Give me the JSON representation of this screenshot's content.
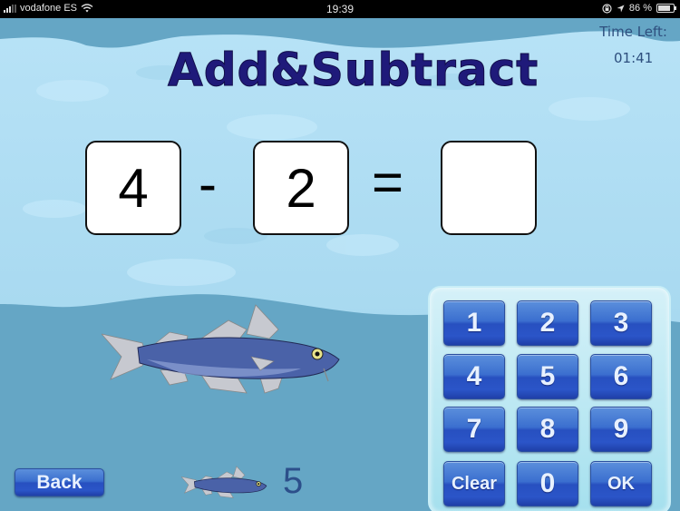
{
  "status_bar": {
    "carrier": "vodafone ES",
    "time": "19:39",
    "battery_percent": "86 %",
    "battery_level": 0.86
  },
  "header": {
    "title": "Add&Subtract",
    "timer_label": "Time Left:",
    "timer_value": "01:41"
  },
  "equation": {
    "operand1": "4",
    "operator": "-",
    "operand2": "2",
    "equals": "=",
    "answer": ""
  },
  "keypad": {
    "keys": [
      "1",
      "2",
      "3",
      "4",
      "5",
      "6",
      "7",
      "8",
      "9",
      "Clear",
      "0",
      "OK"
    ]
  },
  "footer": {
    "back_label": "Back",
    "score": "5"
  },
  "colors": {
    "sky": "#65a6c5",
    "water": "#aedcf2",
    "title": "#1f1a7a",
    "key": "#2b55c8"
  }
}
